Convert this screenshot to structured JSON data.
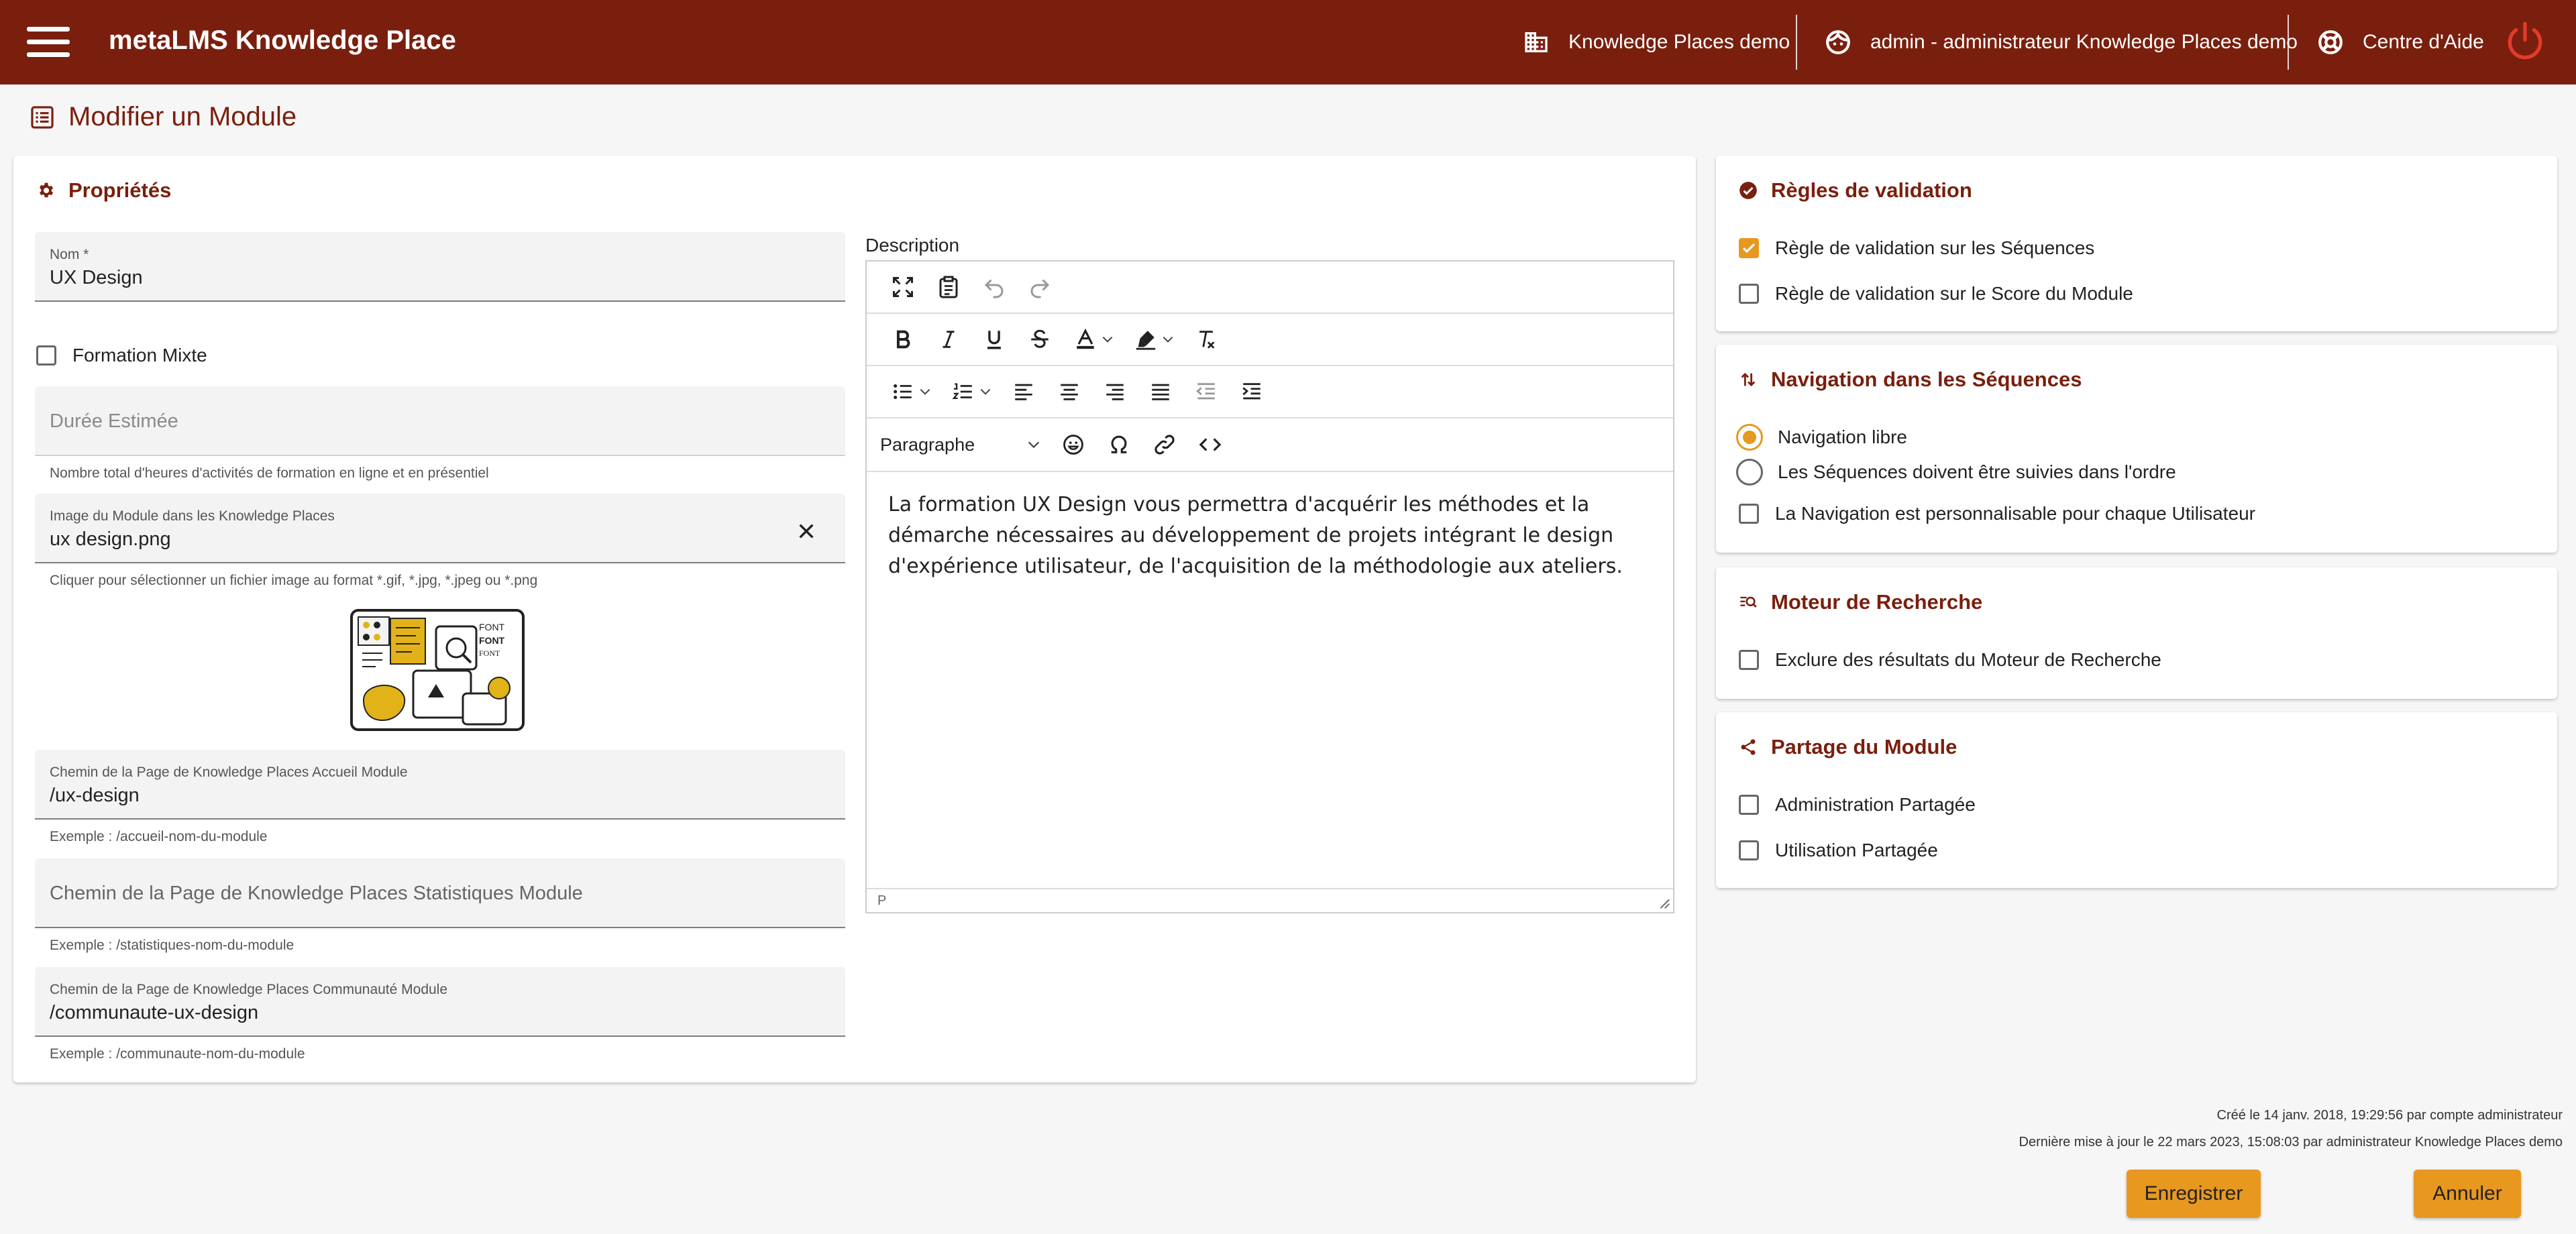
{
  "app": {
    "title": "metaLMS Knowledge Place",
    "workspace": "Knowledge Places demo",
    "user": "admin - administrateur Knowledge Places demo",
    "help": "Centre d'Aide"
  },
  "page": {
    "title": "Modifier un Module"
  },
  "properties": {
    "title": "Propriétés",
    "name": {
      "label": "Nom *",
      "value": "UX Design"
    },
    "mixed_training": {
      "label": "Formation Mixte",
      "checked": false
    },
    "duration": {
      "placeholder": "Durée Estimée",
      "hint": "Nombre total d'heures d'activités de formation en ligne et en présentiel"
    },
    "image": {
      "label": "Image du Module dans les Knowledge Places",
      "value": "ux design.png",
      "hint": "Cliquer pour sélectionner un fichier image au format *.gif, *.jpg, *.jpeg ou *.png"
    },
    "home_path": {
      "label": "Chemin de la Page de Knowledge Places Accueil Module",
      "value": "/ux-design",
      "hint": "Exemple : /accueil-nom-du-module"
    },
    "stats_path": {
      "placeholder": "Chemin de la Page de Knowledge Places Statistiques Module",
      "hint": "Exemple : /statistiques-nom-du-module"
    },
    "community_path": {
      "label": "Chemin de la Page de Knowledge Places Communauté Module",
      "value": "/communaute-ux-design",
      "hint": "Exemple : /communaute-nom-du-module"
    },
    "description": {
      "label": "Description",
      "block_format": "Paragraphe",
      "content": "La formation UX Design vous permettra d'acquérir les méthodes et la démarche nécessaires au développement de projets intégrant le design d'expérience utilisateur, de l'acquisition de la méthodologie aux ateliers.",
      "status_path": "P"
    }
  },
  "validation": {
    "title": "Règles de validation",
    "rules": [
      {
        "label": "Règle de validation sur les Séquences",
        "checked": true
      },
      {
        "label": "Règle de validation sur le Score du Module",
        "checked": false
      }
    ]
  },
  "navigation": {
    "title": "Navigation dans les Séquences",
    "options": [
      {
        "label": "Navigation libre",
        "selected": true
      },
      {
        "label": "Les Séquences doivent être suivies dans l'ordre",
        "selected": false
      }
    ],
    "custom": {
      "label": "La Navigation est personnalisable pour chaque Utilisateur",
      "checked": false
    }
  },
  "search": {
    "title": "Moteur de Recherche",
    "exclude": {
      "label": "Exclure des résultats du Moteur de Recherche",
      "checked": false
    }
  },
  "sharing": {
    "title": "Partage du Module",
    "admin": {
      "label": "Administration Partagée",
      "checked": false
    },
    "usage": {
      "label": "Utilisation Partagée",
      "checked": false
    }
  },
  "footer": {
    "created": "Créé le 14 janv. 2018, 19:29:56 par compte administrateur",
    "updated": "Dernière mise à jour le 22 mars 2023, 15:08:03 par administrateur Knowledge Places demo",
    "save_label": "Enregistrer",
    "cancel_label": "Annuler"
  },
  "colors": {
    "brand": "#7a1f0e",
    "accent": "#e8971f",
    "background": "#f6f6f6"
  },
  "icons": [
    "menu-icon",
    "building-icon",
    "user-face-icon",
    "lifebuoy-icon",
    "power-icon",
    "list-icon",
    "gear-icon",
    "check-circle-icon",
    "sort-arrows-icon",
    "search-list-icon",
    "share-icon",
    "close-icon"
  ]
}
